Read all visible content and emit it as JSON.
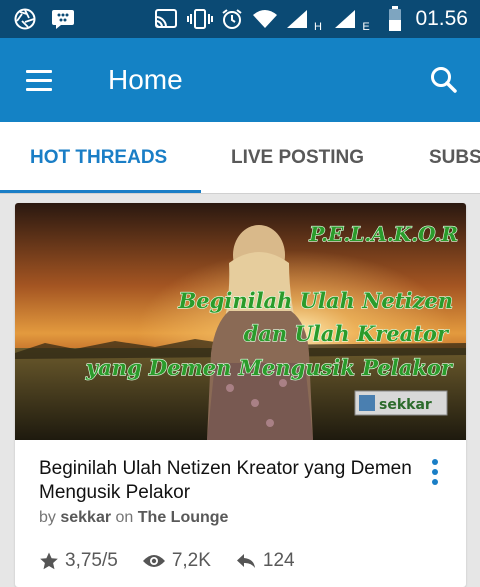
{
  "status_bar": {
    "time": "01.56",
    "net1": "H",
    "net2": "E",
    "icons": [
      "aperture-icon",
      "bbm-icon",
      "cast-icon",
      "vibrate-icon",
      "alarm-icon",
      "wifi-icon",
      "signal-icon",
      "signal-icon",
      "battery-icon"
    ]
  },
  "app_bar": {
    "title": "Home",
    "menu_icon": "hamburger-icon",
    "search_icon": "search-icon"
  },
  "tabs": [
    {
      "label": "HOT THREADS",
      "active": true
    },
    {
      "label": "LIVE POSTING",
      "active": false
    },
    {
      "label": "SUBS",
      "active": false
    }
  ],
  "thread": {
    "image_text": {
      "heading": "P.E.L.A.K.O.R",
      "line1": "Beginilah Ulah Netizen",
      "line2": "dan Ulah Kreator",
      "line3": "yang Demen Mengusik Pelakor",
      "watermark": "sekkar"
    },
    "title": "Beginilah Ulah Netizen Kreator yang Demen Mengusik Pelakor",
    "by_label": "by",
    "author": "sekkar",
    "on_label": "on",
    "forum": "The Lounge",
    "rating": "3,75/5",
    "views": "7,2K",
    "replies": "124"
  },
  "colors": {
    "status_bar": "#0b4a74",
    "app_bar": "#1482c5",
    "accent": "#1a7ec6"
  }
}
